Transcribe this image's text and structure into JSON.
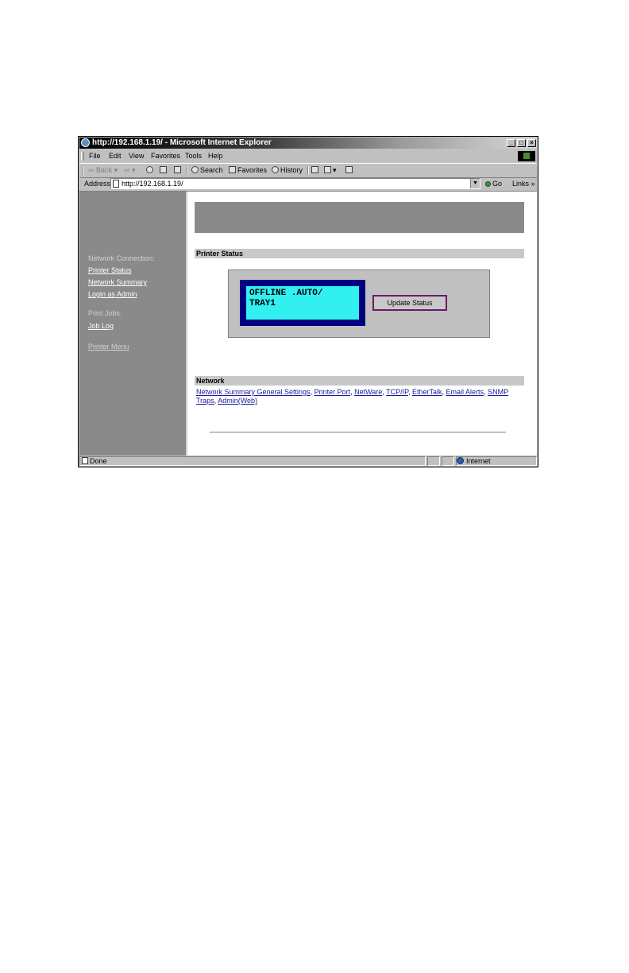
{
  "window": {
    "title": "http://192.168.1.19/ - Microsoft Internet Explorer",
    "controls": {
      "minimize": "_",
      "maximize": "□",
      "close": "×"
    }
  },
  "menu": [
    "File",
    "Edit",
    "View",
    "Favorites",
    "Tools",
    "Help"
  ],
  "toolbar": {
    "back": "Back",
    "search": "Search",
    "favorites": "Favorites",
    "history": "History"
  },
  "address": {
    "label": "Address",
    "url": "http://192.168.1.19/",
    "go": "Go",
    "links": "Links »"
  },
  "sidebar": {
    "network_heading": "Network Connection:",
    "printer_status": "Printer Status",
    "network_summary": "Network Summary",
    "login_admin": "Login as Admin",
    "print_jobs_heading": "Print Jobs:",
    "job_log": "Job Log",
    "printer_menu": "Printer Menu"
  },
  "main": {
    "printer_status_heading": "Printer Status",
    "lcd_line1": "OFFLINE .AUTO/",
    "lcd_line2": "TRAY1",
    "update_button": "Update Status",
    "network_heading": "Network",
    "network_links": [
      "Network Summary General Settings",
      "Printer Port",
      "NetWare",
      "TCP/IP",
      "EtherTalk",
      "Email Alerts",
      "SNMP Traps",
      "Admin(Web)"
    ]
  },
  "statusbar": {
    "status": "Done",
    "zone": "Internet"
  }
}
